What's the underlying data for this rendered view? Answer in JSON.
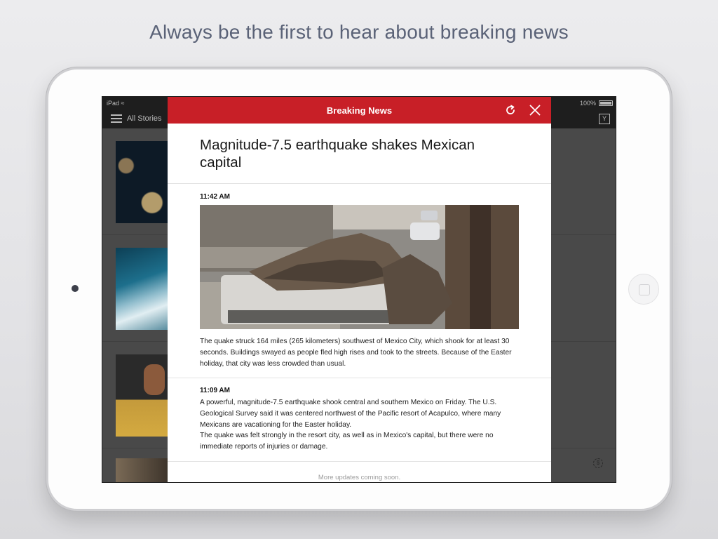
{
  "promo": {
    "tagline": "Always be the first to hear about breaking news"
  },
  "statusbar": {
    "device": "iPad",
    "battery": "100%"
  },
  "navbar": {
    "section_label": "All Stories"
  },
  "modal": {
    "title": "Breaking News",
    "headline": "Magnitude-7.5 earthquake shakes Mexican capital",
    "updates": [
      {
        "time": "11:42 AM",
        "text": "The quake struck 164 miles (265 kilometers) southwest of Mexico City, which shook for at least 30 seconds. Buildings swayed as people fled high rises and took to the streets. Because of the Easter holiday, that city was less crowded than usual."
      },
      {
        "time": "11:09 AM",
        "text_1": "A powerful, magnitude-7.5 earthquake shook central and southern Mexico on Friday. The U.S. Geological Survey said it was centered northwest of the Pacific resort of Acapulco, where many Mexicans are vacationing for the Easter holiday.",
        "text_2": "The quake was felt strongly in the resort city, as well as in Mexico's capital, but there were no immediate reports of injuries or damage."
      }
    ],
    "footer": "More updates coming soon."
  },
  "icons": {
    "menu": "hamburger-menu-icon",
    "yahoo": "yahoo-app-icon",
    "refresh": "refresh-icon",
    "close": "close-icon",
    "sponsor": "sponsored-icon"
  },
  "colors": {
    "header_red": "#c81f27",
    "tagline": "#5a6277"
  }
}
